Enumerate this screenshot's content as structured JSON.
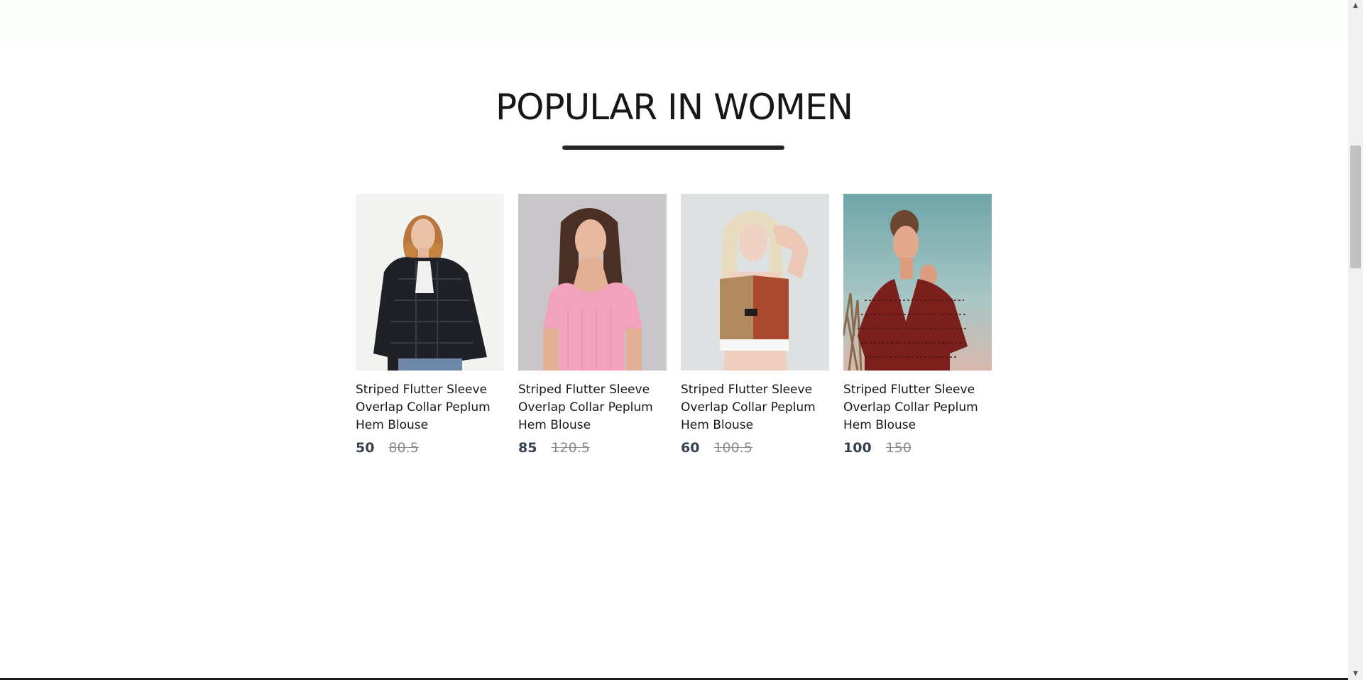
{
  "section": {
    "title": "POPULAR IN WOMEN"
  },
  "products": [
    {
      "name": "Striped Flutter Sleeve Overlap Collar Peplum Hem Blouse",
      "new_price": "50",
      "old_price": "80.5",
      "image_icon": "woman-black-fur-jacket-image"
    },
    {
      "name": "Striped Flutter Sleeve Overlap Collar Peplum Hem Blouse",
      "new_price": "85",
      "old_price": "120.5",
      "image_icon": "woman-pink-top-image"
    },
    {
      "name": "Striped Flutter Sleeve Overlap Collar Peplum Hem Blouse",
      "new_price": "60",
      "old_price": "100.5",
      "image_icon": "woman-sports-bra-image"
    },
    {
      "name": "Striped Flutter Sleeve Overlap Collar Peplum Hem Blouse",
      "new_price": "100",
      "old_price": "150",
      "image_icon": "woman-red-dress-image"
    }
  ],
  "colors": {
    "title": "#171717",
    "underline": "#252525",
    "price_new": "#374151",
    "price_old": "#8c8c8c",
    "top_band": "#fbfffb"
  }
}
